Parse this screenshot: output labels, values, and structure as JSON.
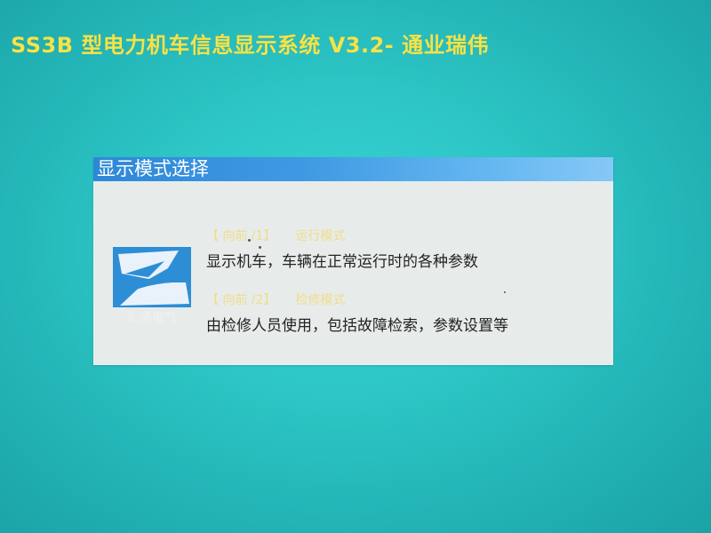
{
  "app": {
    "title": "SS3B 型电力机车信息显示系统 V3.2- 通业瑞伟"
  },
  "dialog": {
    "title": "显示模式选择",
    "logo": {
      "icon": "company-logo-icon",
      "caption": "汇通电气"
    },
    "modes": [
      {
        "hotkey": "【 向前 /1】",
        "name": "运行模式",
        "description": "显示机车，车辆在正常运行时的各种参数"
      },
      {
        "hotkey": "【 向前 /2】",
        "name": "检修模式",
        "description": "由检修人员使用，包括故障检索，参数设置等"
      }
    ]
  },
  "colors": {
    "background": "#2ec7c7",
    "title_text": "#f4e34a",
    "titlebar": "#3f99e2",
    "dialog_body": "#e7eceb",
    "logo_bg": "#2d8ed6",
    "hotkey_text": "#f0dd8a"
  }
}
